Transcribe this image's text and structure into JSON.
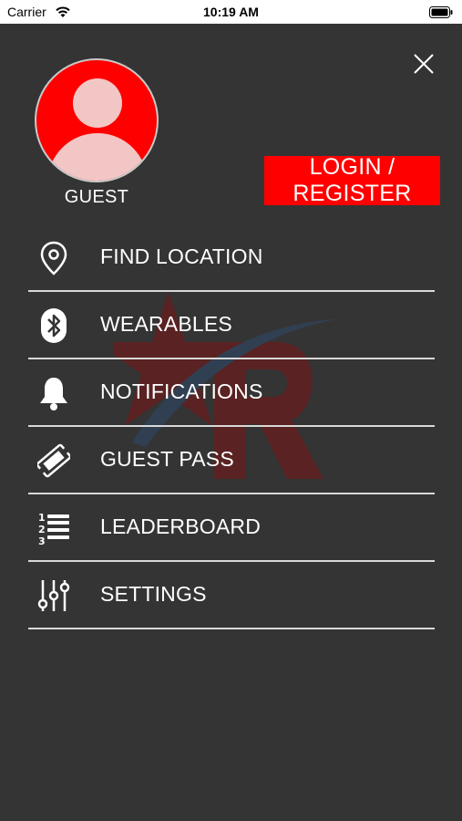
{
  "status_bar": {
    "carrier": "Carrier",
    "time": "10:19 AM"
  },
  "profile": {
    "name": "GUEST"
  },
  "login_button": {
    "label": "LOGIN / REGISTER"
  },
  "menu": {
    "items": [
      {
        "label": "FIND LOCATION",
        "icon": "location-pin-icon"
      },
      {
        "label": "WEARABLES",
        "icon": "bluetooth-icon"
      },
      {
        "label": "NOTIFICATIONS",
        "icon": "bell-icon"
      },
      {
        "label": "GUEST PASS",
        "icon": "ticket-icon"
      },
      {
        "label": "LEADERBOARD",
        "icon": "numbered-list-icon"
      },
      {
        "label": "SETTINGS",
        "icon": "sliders-icon"
      }
    ]
  },
  "colors": {
    "background": "#343434",
    "accent": "#ff0000",
    "text": "#ffffff",
    "divider": "#d8d8d8"
  }
}
